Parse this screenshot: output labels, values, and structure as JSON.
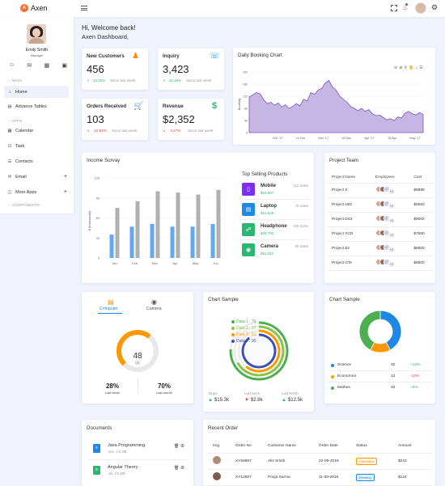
{
  "app": {
    "name": "Axen"
  },
  "user": {
    "name": "Emily Smith",
    "role": "Manager"
  },
  "sidebar": {
    "sections": {
      "main": "-- MAIN",
      "apps": "-- APPS",
      "components": "-- COMPONENTS"
    },
    "items": [
      {
        "label": "Home",
        "icon": "home-icon"
      },
      {
        "label": "Advance Tables",
        "icon": "table-icon"
      },
      {
        "label": "Calendar",
        "icon": "calendar-icon"
      },
      {
        "label": "Task",
        "icon": "task-icon"
      },
      {
        "label": "Contacts",
        "icon": "contacts-icon"
      },
      {
        "label": "Email",
        "icon": "email-icon",
        "plus": "+"
      },
      {
        "label": "More Apps",
        "icon": "apps-icon",
        "plus": "+"
      }
    ]
  },
  "welcome": {
    "line1": "Hi, Welcome back!",
    "line2": "Axen Dashboard,"
  },
  "stats": [
    {
      "title": "New Customers",
      "value": "456",
      "change": "10.32%",
      "note": "Since last week",
      "trend": "up",
      "color": "#ff8a00",
      "icon": "users-icon"
    },
    {
      "title": "Inquiry",
      "value": "3,423",
      "change": "21.19%",
      "note": "Since last week",
      "trend": "up",
      "color": "#1e88e5",
      "icon": "headset-icon"
    },
    {
      "title": "Orders Received",
      "value": "103",
      "change": "-10.64%",
      "note": "Since last week",
      "trend": "down",
      "color": "#7b2ff7",
      "icon": "cart-icon"
    },
    {
      "title": "Revenue",
      "value": "$2,352",
      "change": "-4.27%",
      "note": "Since last week",
      "trend": "down",
      "color": "#2bb673",
      "icon": "dollar-icon"
    }
  ],
  "booking": {
    "title": "Daily Booking Chart",
    "ylabel": "Booking",
    "yticks": [
      "200",
      "160",
      "120",
      "80",
      "40",
      "0"
    ],
    "xticks": [
      "Feb '17",
      "15 Feb",
      "Mar '17",
      "15 Mar",
      "Apr '17",
      "15 Apr",
      "May '17"
    ]
  },
  "income": {
    "title": "Income Survay",
    "ylabel": "$ (thousands)",
    "yticks": [
      "120",
      "90",
      "60",
      "30",
      "0"
    ],
    "xticks": [
      "Jan",
      "Feb",
      "Mar",
      "Apr",
      "May",
      "Jun"
    ]
  },
  "top_products": {
    "title": "Top Selling Products",
    "items": [
      {
        "name": "Mobile",
        "price": "$24,897",
        "sales": "112 Sales",
        "color": "#7b2ff7",
        "icon": "mobile-icon"
      },
      {
        "name": "Laptop",
        "price": "$12,629",
        "sales": "76 Sales",
        "color": "#1e88e5",
        "icon": "laptop-icon"
      },
      {
        "name": "Headphone",
        "price": "$34,792",
        "sales": "225 Sales",
        "color": "#2bb673",
        "icon": "headphone-icon"
      },
      {
        "name": "Camera",
        "price": "$11,523",
        "sales": "90 Sales",
        "color": "#2bb673",
        "icon": "camera-icon"
      }
    ]
  },
  "project_team": {
    "title": "Project Team",
    "headers": [
      "Project Name",
      "Employees",
      "Cost"
    ],
    "rows": [
      {
        "name": "Project X",
        "more": "+2",
        "cost": "$8999"
      },
      {
        "name": "Project AB2",
        "more": "+2",
        "cost": "$5550"
      },
      {
        "name": "Project DS3",
        "more": "+4",
        "cost": "$9000"
      },
      {
        "name": "Project XCD",
        "more": "+2",
        "cost": "$7500"
      },
      {
        "name": "Project Z2",
        "more": "+2",
        "cost": "$8500"
      },
      {
        "name": "Project GTe",
        "more": "+2",
        "cost": "$8500"
      }
    ]
  },
  "device_card": {
    "tabs": [
      "Computer",
      "Camera"
    ],
    "gauge_value": "48",
    "gauge_unit": "Qty",
    "gauge_level": 0.48,
    "stats": [
      {
        "value": "28%",
        "label": "Last week"
      },
      {
        "value": "70%",
        "label": "Last month"
      }
    ]
  },
  "chart_sample_1": {
    "title": "Chart Sample",
    "legend": [
      {
        "label": "Data 1 : 76",
        "color": "#4caf50"
      },
      {
        "label": "Data 2 : 67",
        "color": "#8bc34a"
      },
      {
        "label": "Data 3 : 61",
        "color": "#ff9800"
      },
      {
        "label": "Data 4 : 90",
        "color": "#3f51b5"
      }
    ],
    "footer": [
      {
        "label": "Target",
        "value": "$15.3k",
        "trend": "up"
      },
      {
        "label": "Last week",
        "value": "$2.8k",
        "trend": "down"
      },
      {
        "label": "Last Month",
        "value": "$12.5k",
        "trend": "up"
      }
    ]
  },
  "chart_sample_2": {
    "title": "Chart Sample",
    "rows": [
      {
        "label": "Science",
        "value": "32",
        "change": "+12%",
        "trend": "up",
        "color": "#1e88e5"
      },
      {
        "label": "Economics",
        "value": "12",
        "change": "-12%",
        "trend": "down",
        "color": "#ff9800"
      },
      {
        "label": "Mathes",
        "value": "32",
        "change": "+3%",
        "trend": "up",
        "color": "#4caf50"
      }
    ]
  },
  "documents": {
    "title": "Documents",
    "items": [
      {
        "name": "Java Programming",
        "meta": ".doc, 4.5 MB",
        "color": "#1e88e5"
      },
      {
        "name": "Angular Theory",
        "meta": ".xls, 2.5 MB",
        "color": "#2bb673"
      }
    ]
  },
  "recent_order": {
    "title": "Recent Order",
    "headers": [
      "Img",
      "Order No",
      "Customer Name",
      "Order Date",
      "Status",
      "Amount"
    ],
    "rows": [
      {
        "order": "XY56987",
        "customer": "Alis Smith",
        "date": "22-09-2019",
        "status": "Cancelled",
        "status_color": "#ff9800",
        "amount": "$223"
      },
      {
        "order": "XY12587",
        "customer": "Pooja Sarma",
        "date": "11-09-2019",
        "status": "Pending",
        "status_color": "#1e88e5",
        "amount": "$124"
      }
    ]
  },
  "chart_data": [
    {
      "type": "area",
      "title": "Daily Booking Chart",
      "ylabel": "Booking",
      "ylim": [
        0,
        200
      ],
      "x": [
        "Feb '17",
        "15 Feb",
        "Mar '17",
        "15 Mar",
        "Apr '17",
        "15 Apr",
        "May '17"
      ],
      "values": [
        118,
        124,
        132,
        128,
        108,
        96,
        100,
        90,
        98,
        84,
        92,
        80,
        86,
        96,
        88,
        110,
        104,
        132,
        126,
        140,
        146,
        164,
        172,
        150,
        140,
        120,
        110,
        100,
        86,
        80,
        72,
        80,
        70,
        76,
        62,
        56,
        58,
        50,
        42,
        46,
        40,
        52,
        48,
        64,
        70,
        62,
        58,
        66,
        60
      ]
    },
    {
      "type": "bar",
      "title": "Income Survay",
      "ylabel": "$ (thousands)",
      "ylim": [
        0,
        120
      ],
      "categories": [
        "Jan",
        "Feb",
        "Mar",
        "Apr",
        "May",
        "Jun"
      ],
      "series": [
        {
          "values": [
            35,
            47,
            51,
            47,
            47,
            51
          ]
        },
        {
          "values": [
            75,
            85,
            100,
            98,
            95,
            102
          ]
        }
      ]
    },
    {
      "type": "pie",
      "title": "Chart Sample",
      "labels": [
        "Data 1",
        "Data 2",
        "Data 3",
        "Data 4"
      ],
      "values": [
        76,
        67,
        61,
        90
      ]
    },
    {
      "type": "pie",
      "title": "Chart Sample",
      "labels": [
        "Science",
        "Economics",
        "Mathes"
      ],
      "values": [
        32,
        12,
        32
      ]
    }
  ]
}
